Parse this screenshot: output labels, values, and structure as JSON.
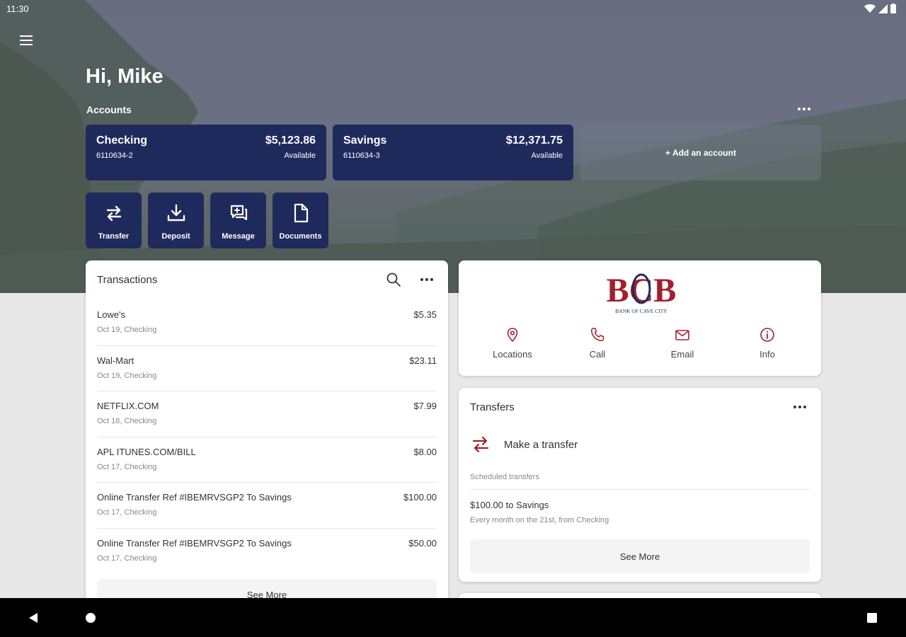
{
  "status_bar": {
    "time": "11:30"
  },
  "header": {
    "greeting": "Hi, Mike",
    "accounts_label": "Accounts"
  },
  "accounts": [
    {
      "name": "Checking",
      "number": "6110634-2",
      "balance": "$5,123.86",
      "balance_label": "Available"
    },
    {
      "name": "Savings",
      "number": "6110634-3",
      "balance": "$12,371.75",
      "balance_label": "Available"
    }
  ],
  "add_account_label": "+ Add an account",
  "quick_actions": [
    {
      "label": "Transfer",
      "icon": "transfer-icon"
    },
    {
      "label": "Deposit",
      "icon": "deposit-icon"
    },
    {
      "label": "Message",
      "icon": "message-icon"
    },
    {
      "label": "Documents",
      "icon": "document-icon"
    }
  ],
  "transactions": {
    "title": "Transactions",
    "items": [
      {
        "name": "Lowe's",
        "amount": "$5.35",
        "sub": "Oct 19, Checking"
      },
      {
        "name": "Wal-Mart",
        "amount": "$23.11",
        "sub": "Oct 19, Checking"
      },
      {
        "name": "NETFLIX.COM",
        "amount": "$7.99",
        "sub": "Oct 18, Checking"
      },
      {
        "name": "APL ITUNES.COM/BILL",
        "amount": "$8.00",
        "sub": "Oct 17, Checking"
      },
      {
        "name": "Online Transfer Ref #IBEMRVSGP2 To Savings",
        "amount": "$100.00",
        "sub": "Oct 17, Checking"
      },
      {
        "name": "Online Transfer Ref #IBEMRVSGP2 To Savings",
        "amount": "$50.00",
        "sub": "Oct 17, Checking"
      }
    ],
    "see_more": "See More"
  },
  "bank": {
    "logo_text": "BANK OF CAVE CITY",
    "actions": [
      {
        "label": "Locations",
        "icon": "location-pin-icon"
      },
      {
        "label": "Call",
        "icon": "phone-icon"
      },
      {
        "label": "Email",
        "icon": "email-icon"
      },
      {
        "label": "Info",
        "icon": "info-icon"
      }
    ]
  },
  "transfers": {
    "title": "Transfers",
    "make_transfer": "Make a transfer",
    "scheduled_label": "Scheduled transfers",
    "scheduled_title": "$100.00 to Savings",
    "scheduled_sub": "Every month on the 21st, from Checking",
    "see_more": "See More"
  },
  "colors": {
    "navy": "#1f2a5c",
    "brand_red": "#a31f2d"
  }
}
